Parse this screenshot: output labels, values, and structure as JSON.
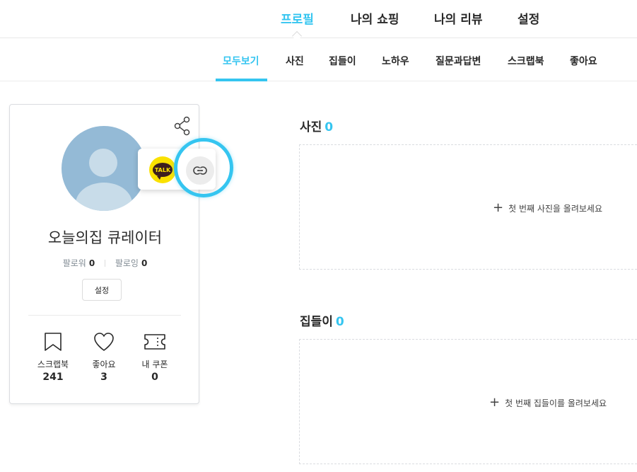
{
  "top_nav": [
    {
      "label": "프로필",
      "active": true
    },
    {
      "label": "나의 쇼핑",
      "active": false
    },
    {
      "label": "나의 리뷰",
      "active": false
    },
    {
      "label": "설정",
      "active": false
    }
  ],
  "sub_nav": [
    {
      "label": "모두보기",
      "active": true
    },
    {
      "label": "사진",
      "active": false
    },
    {
      "label": "집들이",
      "active": false
    },
    {
      "label": "노하우",
      "active": false
    },
    {
      "label": "질문과답변",
      "active": false
    },
    {
      "label": "스크랩북",
      "active": false
    },
    {
      "label": "좋아요",
      "active": false
    }
  ],
  "profile": {
    "name": "오늘의집 큐레이터",
    "follower_label": "팔로워",
    "follower_count": "0",
    "following_label": "팔로잉",
    "following_count": "0",
    "settings_button": "설정",
    "kakao_text": "TALK",
    "stats": [
      {
        "label": "스크랩북",
        "value": "241",
        "icon": "bookmark-icon"
      },
      {
        "label": "좋아요",
        "value": "3",
        "icon": "heart-icon"
      },
      {
        "label": "내 쿠폰",
        "value": "0",
        "icon": "coupon-icon"
      }
    ]
  },
  "sections": {
    "photos": {
      "title": "사진",
      "count": "0",
      "empty_text": "첫 번째 사진을 올려보세요"
    },
    "housewarming": {
      "title": "집들이",
      "count": "0",
      "empty_text": "첫 번째 집들이를 올려보세요"
    }
  },
  "colors": {
    "accent": "#35c5f0",
    "kakao": "#fae100"
  }
}
